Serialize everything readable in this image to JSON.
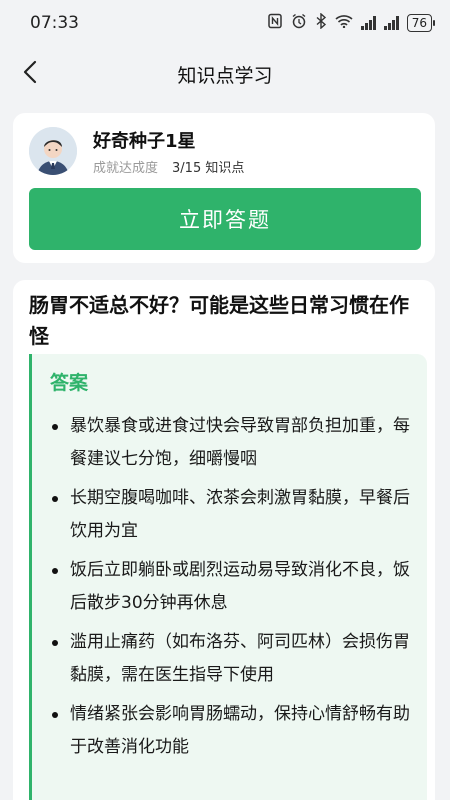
{
  "status_bar": {
    "time": "07:33",
    "battery": "76",
    "icons": [
      "nfc-icon",
      "alarm-icon",
      "bluetooth-icon",
      "wifi-icon",
      "signal-icon",
      "signal-icon",
      "battery-icon"
    ]
  },
  "nav": {
    "title": "知识点学习",
    "back_icon": "chevron-left-icon"
  },
  "profile": {
    "name": "好奇种子1星",
    "progress_label": "成就达成度",
    "progress_value": "3/15 知识点",
    "button_label": "立即答题",
    "accent_color": "#2fb36b"
  },
  "article": {
    "title": "肠胃不适总不好？可能是这些日常习惯在作怪",
    "answer_heading": "答案",
    "items": [
      "暴饮暴食或进食过快会导致胃部负担加重，每餐建议七分饱，细嚼慢咽",
      "长期空腹喝咖啡、浓茶会刺激胃黏膜，早餐后饮用为宜",
      "饭后立即躺卧或剧烈运动易导致消化不良，饭后散步30分钟再休息",
      "滥用止痛药（如布洛芬、阿司匹林）会损伤胃黏膜，需在医生指导下使用",
      "情绪紧张会影响胃肠蠕动，保持心情舒畅有助于改善消化功能"
    ]
  }
}
